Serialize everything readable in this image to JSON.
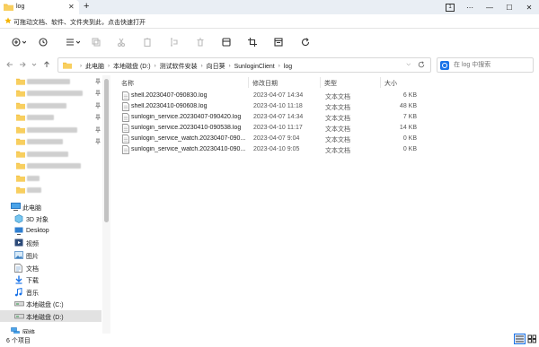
{
  "tab": {
    "title": "log",
    "close": "✕",
    "new_tab": "+"
  },
  "window": {
    "tab_count": "1",
    "more": "⋯",
    "minimize": "—",
    "maximize": "☐",
    "close": "✕"
  },
  "quick_bar": {
    "text": "可拖动文档、软件、文件夹到此，点击快速打开"
  },
  "toolbar": {
    "icons": [
      "new-icon",
      "recent-icon",
      "view-menu-icon",
      "copy-icon",
      "cut-icon",
      "paste-icon",
      "rename-icon",
      "delete-icon",
      "share-icon",
      "crop-icon",
      "preview-icon",
      "rotate-icon"
    ]
  },
  "address": {
    "crumbs": [
      "此电脑",
      "本地磁盘 (D:)",
      "测试软件安装",
      "向日葵",
      "SunloginClient",
      "log"
    ]
  },
  "search": {
    "placeholder": "在 log 中搜索"
  },
  "sidebar": {
    "nav": [
      {
        "label": "此电脑",
        "icon": "this-pc-icon"
      },
      {
        "label": "3D 对象",
        "icon": "3d-objects-icon"
      },
      {
        "label": "Desktop",
        "icon": "desktop-icon"
      },
      {
        "label": "视频",
        "icon": "videos-icon"
      },
      {
        "label": "图片",
        "icon": "pictures-icon"
      },
      {
        "label": "文档",
        "icon": "documents-icon"
      },
      {
        "label": "下载",
        "icon": "downloads-icon"
      },
      {
        "label": "音乐",
        "icon": "music-icon"
      },
      {
        "label": "本地磁盘 (C:)",
        "icon": "drive-icon"
      },
      {
        "label": "本地磁盘 (D:)",
        "icon": "drive-icon"
      },
      {
        "label": "网络",
        "icon": "network-icon"
      }
    ]
  },
  "columns": {
    "name": "名称",
    "date": "修改日期",
    "type": "类型",
    "size": "大小"
  },
  "files": [
    {
      "name": "shell.20230407-090830.log",
      "date": "2023-04-07 14:34",
      "type": "文本文档",
      "size": "6 KB"
    },
    {
      "name": "shell.20230410-090608.log",
      "date": "2023-04-10 11:18",
      "type": "文本文档",
      "size": "48 KB"
    },
    {
      "name": "sunlogin_service.20230407-090420.log",
      "date": "2023-04-07 14:34",
      "type": "文本文档",
      "size": "7 KB"
    },
    {
      "name": "sunlogin_service.20230410-090538.log",
      "date": "2023-04-10 11:17",
      "type": "文本文档",
      "size": "14 KB"
    },
    {
      "name": "sunlogin_service_watch.20230407-090...",
      "date": "2023-04-07 9:04",
      "type": "文本文档",
      "size": "0 KB"
    },
    {
      "name": "sunlogin_service_watch.20230410-090...",
      "date": "2023-04-10 9:05",
      "type": "文本文档",
      "size": "0 KB"
    }
  ],
  "status": {
    "count": "6 个项目"
  },
  "colors": {
    "accent": "#1a73e8",
    "folder": "#f5c34a",
    "selected": "#e2e2e2"
  }
}
